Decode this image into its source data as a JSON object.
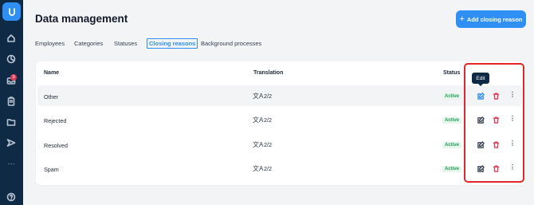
{
  "sidebar": {
    "logo_letter": "u",
    "notification_count": "3",
    "items": [
      {
        "name": "home-icon"
      },
      {
        "name": "analytics-icon"
      },
      {
        "name": "inbox-icon"
      },
      {
        "name": "clipboard-icon"
      },
      {
        "name": "folder-icon"
      },
      {
        "name": "send-icon"
      },
      {
        "name": "more-icon",
        "glyph": "···"
      },
      {
        "name": "help-icon"
      }
    ]
  },
  "header": {
    "title": "Data management",
    "add_button_label": "Add closing reason"
  },
  "tabs": [
    {
      "label": "Employees",
      "active": false
    },
    {
      "label": "Categories",
      "active": false
    },
    {
      "label": "Statuses",
      "active": false
    },
    {
      "label": "Closing reasons",
      "active": true
    },
    {
      "label": "Background processes",
      "active": false
    }
  ],
  "table": {
    "columns": {
      "name": "Name",
      "translation": "Translation",
      "status": "Status"
    },
    "rows": [
      {
        "name": "Other",
        "translation": "2/2",
        "status": "Active"
      },
      {
        "name": "Rejected",
        "translation": "2/2",
        "status": "Active"
      },
      {
        "name": "Resolved",
        "translation": "2/2",
        "status": "Active"
      },
      {
        "name": "Spam",
        "translation": "2/2",
        "status": "Active"
      }
    ]
  },
  "tooltip": {
    "text": "Edit"
  },
  "icons": {
    "translate": "文A",
    "more": "⋮"
  },
  "colors": {
    "accent": "#2f8ff5",
    "sidebar": "#0f2a44",
    "danger": "#e23b57",
    "success": "#22a159",
    "highlight": "#e52626"
  }
}
